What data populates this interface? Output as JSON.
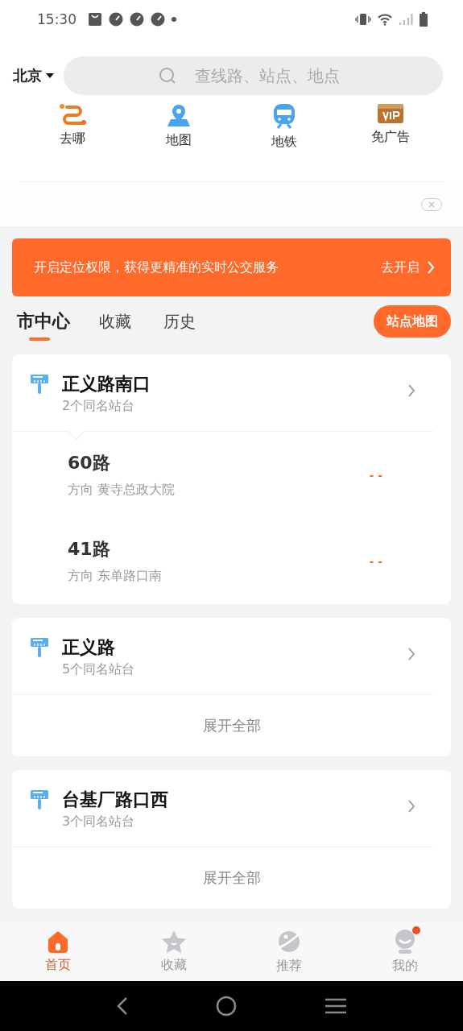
{
  "status_bar": {
    "time": "15:30"
  },
  "header": {
    "city": "北京",
    "search": {
      "placeholder": "查线路、站点、地点"
    }
  },
  "quick_links": [
    {
      "kind": "route",
      "label": "去哪"
    },
    {
      "kind": "map",
      "label": "地图"
    },
    {
      "kind": "metro",
      "label": "地铁"
    },
    {
      "kind": "vip",
      "label": "免广告"
    }
  ],
  "location_banner": {
    "text": "开启定位权限，获得更精准的实时公交服务",
    "action": "去开启"
  },
  "tabs": [
    {
      "label": "市中心",
      "selected": true
    },
    {
      "label": "收藏",
      "selected": false
    },
    {
      "label": "历史",
      "selected": false
    }
  ],
  "map_button": "站点地图",
  "stations": [
    {
      "name": "正义路南口",
      "subtitle": "2个同名站台",
      "expanded": true,
      "routes": [
        {
          "name": "60路",
          "direction": "方向 黄寺总政大院",
          "eta": "- -"
        },
        {
          "name": "41路",
          "direction": "方向 东单路口南",
          "eta": "- -"
        }
      ]
    },
    {
      "name": "正义路",
      "subtitle": "5个同名站台",
      "expanded": false,
      "expand_label": "展开全部"
    },
    {
      "name": "台基厂路口西",
      "subtitle": "3个同名站台",
      "expanded": false,
      "expand_label": "展开全部"
    }
  ],
  "bottom_nav": [
    {
      "kind": "home",
      "label": "首页",
      "selected": true,
      "badge": false
    },
    {
      "kind": "star",
      "label": "收藏",
      "selected": false,
      "badge": false
    },
    {
      "kind": "planet",
      "label": "推荐",
      "selected": false,
      "badge": false
    },
    {
      "kind": "profile",
      "label": "我的",
      "selected": false,
      "badge": true
    }
  ]
}
